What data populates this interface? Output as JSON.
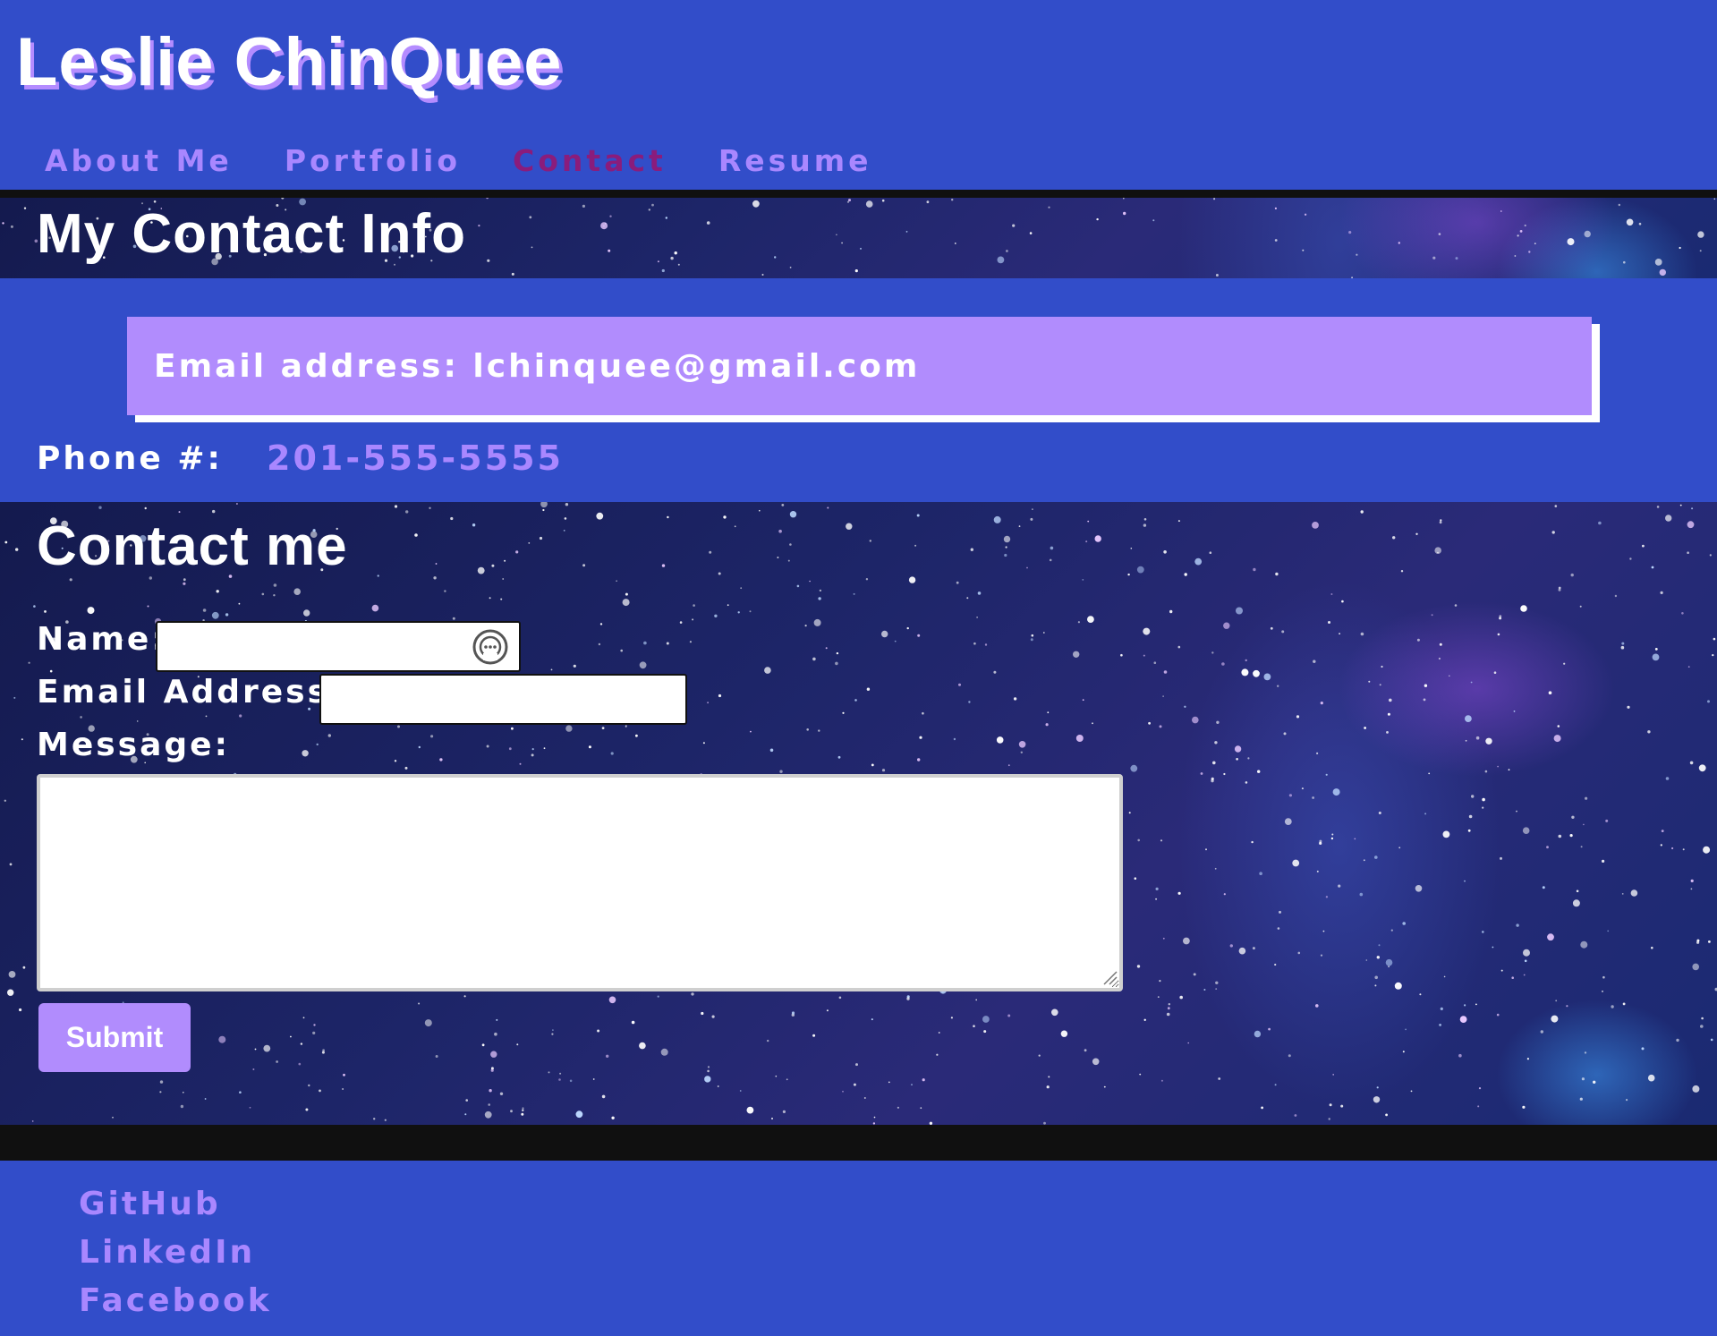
{
  "site": {
    "title": "Leslie ChinQuee"
  },
  "nav": {
    "items": [
      {
        "label": "About Me",
        "active": false
      },
      {
        "label": "Portfolio",
        "active": false
      },
      {
        "label": "Contact",
        "active": true
      },
      {
        "label": "Resume",
        "active": false
      }
    ]
  },
  "contact_info": {
    "heading": "My Contact Info",
    "email_line": "Email address: lchinquee@gmail.com",
    "phone_label": "Phone #:",
    "phone_value": "201-555-5555"
  },
  "contact_form": {
    "heading": "Contact me",
    "name_label": "Name:",
    "name_value": "",
    "email_label": "Email Address:",
    "email_value": "",
    "message_label": "Message:",
    "message_value": "",
    "submit_label": "Submit",
    "name_field_icon": "password-manager-icon"
  },
  "footer": {
    "links": [
      {
        "label": "GitHub"
      },
      {
        "label": "LinkedIn"
      },
      {
        "label": "Facebook"
      }
    ]
  },
  "colors": {
    "page_background": "#324dc9",
    "accent": "#b18cfd",
    "link": "#a987ff",
    "active_nav": "#8a1c7c",
    "rule": "#101010"
  }
}
